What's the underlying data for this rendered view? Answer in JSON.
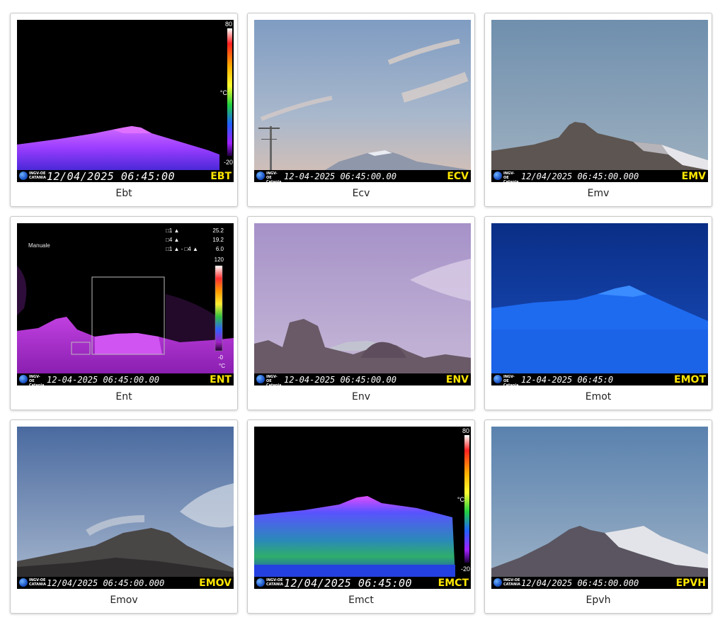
{
  "cameras": [
    {
      "name": "Ebt",
      "timestamp": "12/04/2025 06:45:00",
      "code": "EBT",
      "logo": "INGV-OE CATANIA",
      "scale": {
        "max": "80",
        "unit": "°C",
        "min": "-20"
      }
    },
    {
      "name": "Ecv",
      "timestamp": "12-04-2025 06:45:00.00",
      "code": "ECV",
      "logo": "INGV-OE Catania"
    },
    {
      "name": "Emv",
      "timestamp": "12/04/2025 06:45:00.000",
      "code": "EMV",
      "logo": "INGV-OE Catania"
    },
    {
      "name": "Ent",
      "timestamp": "12-04-2025 06:45:00.00",
      "code": "ENT",
      "logo": "INGV-OE Catania",
      "overlay": {
        "mode": "Manuale",
        "rows": [
          [
            "□1 ▲",
            "25.2"
          ],
          [
            "□4 ▲",
            "19.2"
          ],
          [
            "□1 ▲ - □4 ▲",
            "6.0"
          ]
        ],
        "scale_max": "120",
        "scale_min": "-0",
        "unit": "°C"
      }
    },
    {
      "name": "Env",
      "timestamp": "12-04-2025 06:45:00.00",
      "code": "ENV",
      "logo": "INGV-OE Catania"
    },
    {
      "name": "Emot",
      "timestamp": "12-04-2025 06:45:0",
      "code": "EMOT",
      "logo": "INGV-OE Catania"
    },
    {
      "name": "Emov",
      "timestamp": "12/04/2025 06:45:00.000",
      "code": "EMOV",
      "logo": "INGV-OE CATANIA"
    },
    {
      "name": "Emct",
      "timestamp": "12/04/2025 06:45:00",
      "code": "EMCT",
      "logo": "INGV-OE CATANIA",
      "scale": {
        "max": "80",
        "unit": "°C",
        "min": "-20"
      }
    },
    {
      "name": "Epvh",
      "timestamp": "12/04/2025 06:45:00.000",
      "code": "EPVH",
      "logo": "INGV-OE CATANIA"
    }
  ],
  "colors": {
    "timestamp_text": "#ffffff",
    "code_text": "#ffe600",
    "bar_bg": "#000000"
  }
}
